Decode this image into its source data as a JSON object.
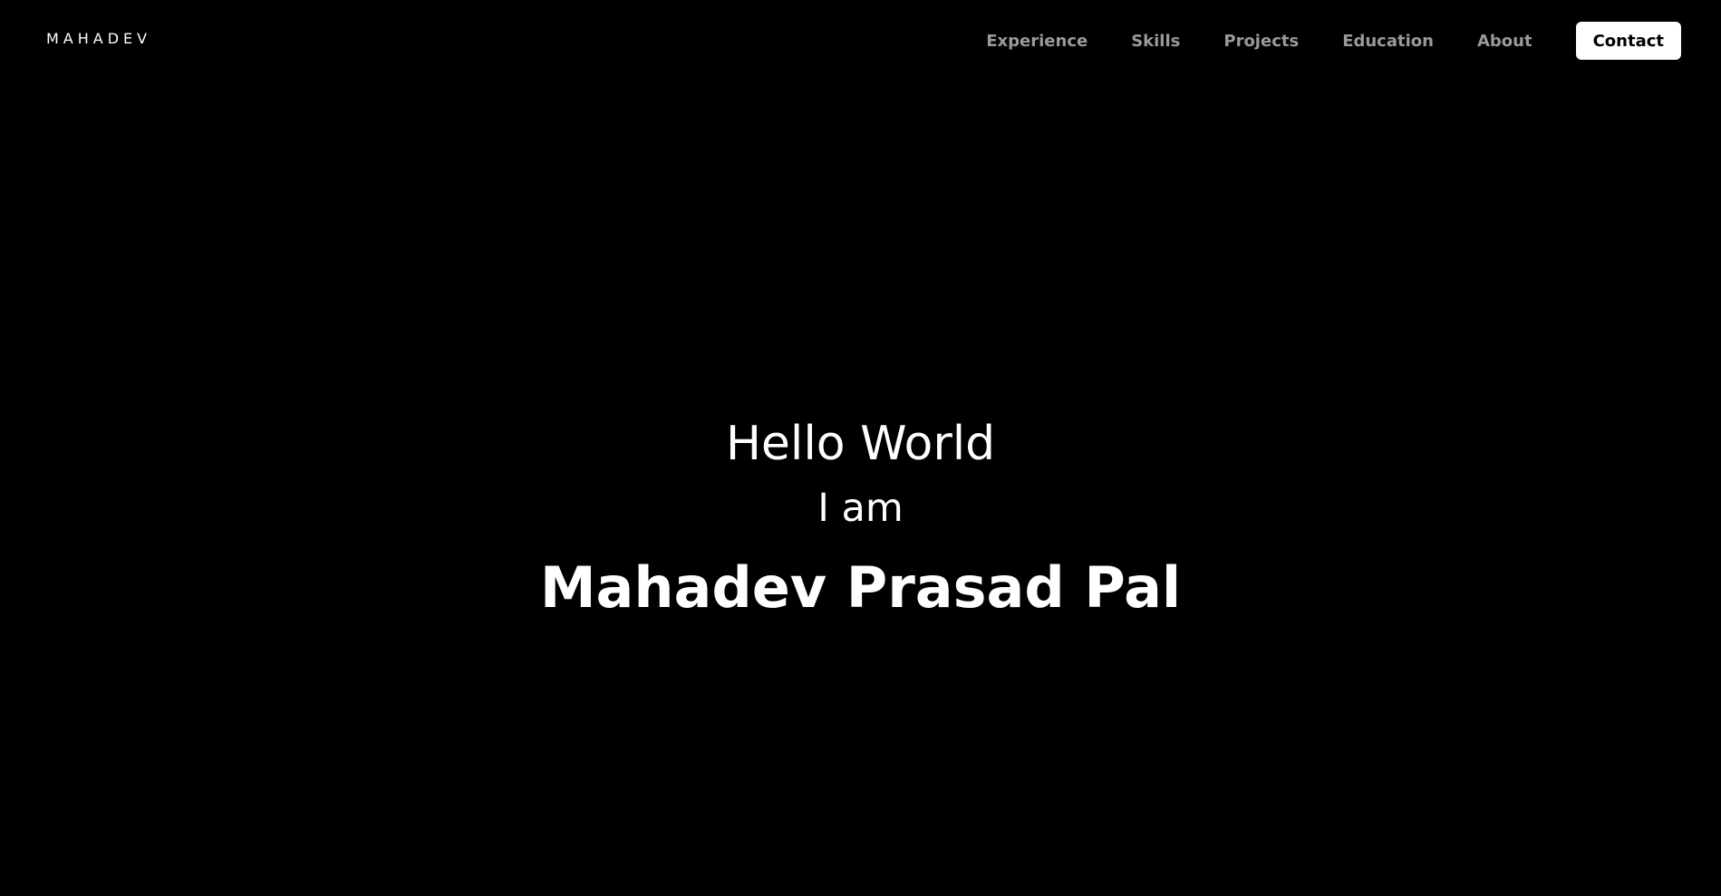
{
  "header": {
    "logo": "MAHADEV",
    "nav": {
      "experience": "Experience",
      "skills": "Skills",
      "projects": "Projects",
      "education": "Education",
      "about": "About",
      "contact": "Contact"
    }
  },
  "hero": {
    "greeting": "Hello World",
    "intro": "I am",
    "name": "Mahadev Prasad Pal"
  },
  "colors": {
    "background": "#000000",
    "text": "#ffffff",
    "nav_text": "#9a9a9a",
    "button_background": "#ffffff",
    "button_text": "#000000"
  }
}
